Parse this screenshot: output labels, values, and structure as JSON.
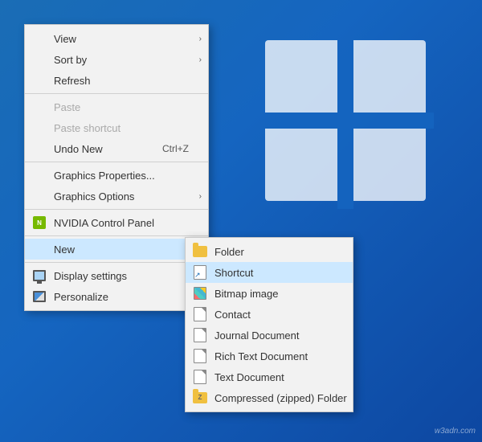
{
  "desktop": {
    "watermark": "w3adn.com"
  },
  "contextMenu": {
    "items": [
      {
        "id": "view",
        "label": "View",
        "hasArrow": true,
        "disabled": false
      },
      {
        "id": "sort-by",
        "label": "Sort by",
        "hasArrow": true,
        "disabled": false
      },
      {
        "id": "refresh",
        "label": "Refresh",
        "hasArrow": false,
        "disabled": false
      },
      {
        "id": "sep1",
        "type": "separator"
      },
      {
        "id": "paste",
        "label": "Paste",
        "hasArrow": false,
        "disabled": true
      },
      {
        "id": "paste-shortcut",
        "label": "Paste shortcut",
        "hasArrow": false,
        "disabled": true
      },
      {
        "id": "undo-new",
        "label": "Undo New",
        "shortcut": "Ctrl+Z",
        "hasArrow": false,
        "disabled": false
      },
      {
        "id": "sep2",
        "type": "separator"
      },
      {
        "id": "graphics-properties",
        "label": "Graphics Properties...",
        "hasArrow": false,
        "disabled": false
      },
      {
        "id": "graphics-options",
        "label": "Graphics Options",
        "hasArrow": true,
        "disabled": false
      },
      {
        "id": "sep3",
        "type": "separator"
      },
      {
        "id": "nvidia",
        "label": "NVIDIA Control Panel",
        "hasArrow": false,
        "icon": "nvidia",
        "disabled": false
      },
      {
        "id": "sep4",
        "type": "separator"
      },
      {
        "id": "new",
        "label": "New",
        "hasArrow": true,
        "highlighted": true,
        "disabled": false
      },
      {
        "id": "sep5",
        "type": "separator"
      },
      {
        "id": "display-settings",
        "label": "Display settings",
        "hasArrow": false,
        "icon": "display",
        "disabled": false
      },
      {
        "id": "personalize",
        "label": "Personalize",
        "hasArrow": false,
        "icon": "personalize",
        "disabled": false
      }
    ]
  },
  "submenu": {
    "items": [
      {
        "id": "folder",
        "label": "Folder",
        "icon": "folder"
      },
      {
        "id": "shortcut",
        "label": "Shortcut",
        "icon": "shortcut",
        "highlighted": true
      },
      {
        "id": "bitmap",
        "label": "Bitmap image",
        "icon": "bitmap"
      },
      {
        "id": "contact",
        "label": "Contact",
        "icon": "doc"
      },
      {
        "id": "journal",
        "label": "Journal Document",
        "icon": "doc"
      },
      {
        "id": "rich-text",
        "label": "Rich Text Document",
        "icon": "doc"
      },
      {
        "id": "text",
        "label": "Text Document",
        "icon": "doc"
      },
      {
        "id": "compressed",
        "label": "Compressed (zipped) Folder",
        "icon": "zip"
      }
    ]
  }
}
